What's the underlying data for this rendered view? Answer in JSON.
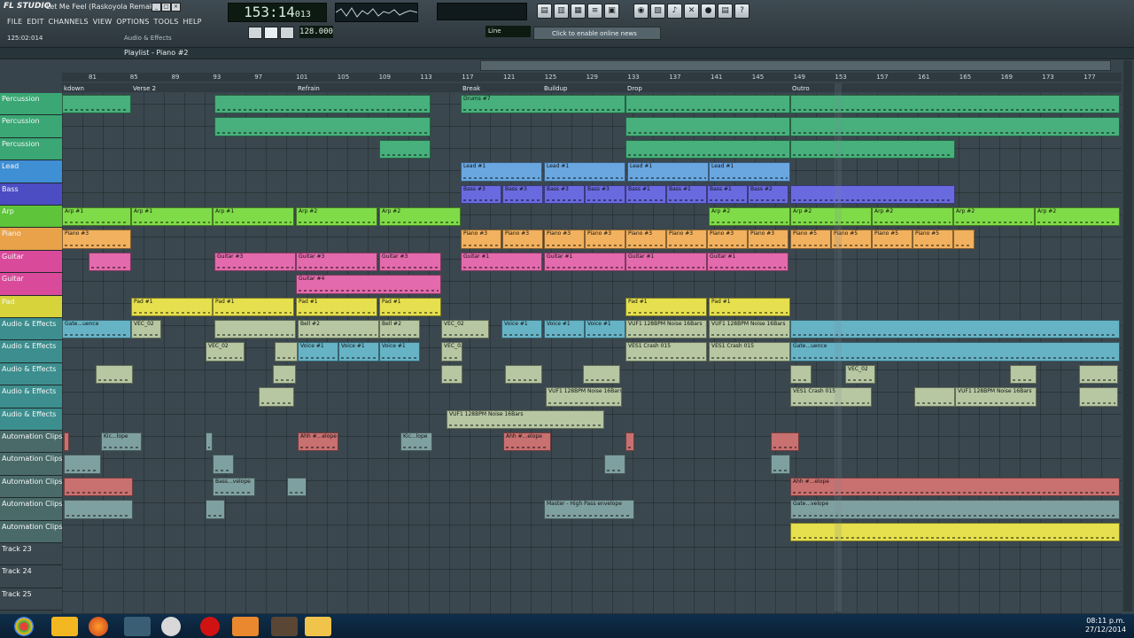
{
  "app": {
    "logo": "FL STUDIO",
    "title": "Let Me Feel (Raskoyola Remake)",
    "menus": [
      "FILE",
      "EDIT",
      "CHANNELS",
      "VIEW",
      "OPTIONS",
      "TOOLS",
      "HELP"
    ],
    "song_position": "125:02:014",
    "hint": "Audio & Effects"
  },
  "transport": {
    "time": "153:14",
    "ticks": "013",
    "tempo": "128.000",
    "pattern": "Line",
    "news": "Click to enable online news"
  },
  "playlist": {
    "title": "Playlist - Piano #2",
    "ruler": [
      "81",
      "85",
      "89",
      "93",
      "97",
      "101",
      "105",
      "109",
      "113",
      "117",
      "121",
      "125",
      "129",
      "133",
      "137",
      "141",
      "145",
      "149",
      "153",
      "157",
      "161",
      "165",
      "169",
      "173",
      "177"
    ],
    "markers": [
      "kdown",
      "Verse 2",
      "Refrain",
      "Break",
      "Buildup",
      "Drop",
      "Outro"
    ]
  },
  "tracks": [
    {
      "name": "Percussion",
      "color": "#3aa774"
    },
    {
      "name": "Percussion",
      "color": "#3aa774"
    },
    {
      "name": "Percussion",
      "color": "#3aa774"
    },
    {
      "name": "Lead",
      "color": "#3f8fd4"
    },
    {
      "name": "Bass",
      "color": "#4c4cc3"
    },
    {
      "name": "Arp",
      "color": "#5ec43a"
    },
    {
      "name": "Piano",
      "color": "#e9a24a"
    },
    {
      "name": "Guitar",
      "color": "#d94a9a"
    },
    {
      "name": "Guitar",
      "color": "#d94a9a"
    },
    {
      "name": "Pad",
      "color": "#d6d43a"
    },
    {
      "name": "Audio & Effects",
      "color": "#3d8e8e"
    },
    {
      "name": "Audio & Effects",
      "color": "#3d8e8e"
    },
    {
      "name": "Audio & Effects",
      "color": "#3d8e8e"
    },
    {
      "name": "Audio & Effects",
      "color": "#3d8e8e"
    },
    {
      "name": "Audio & Effects",
      "color": "#3d8e8e"
    },
    {
      "name": "Automation Clips",
      "color": "#4a6a6a"
    },
    {
      "name": "Automation Clips",
      "color": "#4a6a6a"
    },
    {
      "name": "Automation Clips",
      "color": "#4a6a6a"
    },
    {
      "name": "Automation Clips",
      "color": "#4a6a6a"
    },
    {
      "name": "Automation Clips",
      "color": "#4a6a6a"
    },
    {
      "name": "Track 23",
      "color": "#3a474e"
    },
    {
      "name": "Track 24",
      "color": "#3a474e"
    },
    {
      "name": "Track 25",
      "color": "#3a474e"
    }
  ],
  "clip_labels": {
    "drums": "Drums #7",
    "lead": "Lead #1",
    "bass3": "Bass #3",
    "bass1": "Bass #1",
    "bass2": "Bass #2",
    "arp1": "Arp #1",
    "arp2": "Arp #2",
    "piano3": "Piano #3",
    "piano5": "Piano #5",
    "guitar3": "Guitar #3",
    "guitar4": "Guitar #4",
    "guitar1": "Guitar #1",
    "pad": "Pad #1",
    "voice": "Voice #1",
    "bell": "Bell #2",
    "vec": "VEC_02",
    "noise": "VUF1 128BPM Noise 16Bars",
    "crash": "VES1 Crash 015",
    "gate": "Gate...uence",
    "master": "Master - High Pass envelope",
    "ahh": "Ahh #...elope",
    "kic": "Kic...lope",
    "bass_env": "Bass...velope",
    "gate_env": "Gate...velope"
  },
  "clock": {
    "time": "08:11 p.m.",
    "date": "27/12/2014"
  },
  "colors": {
    "accent": "#5ec43a",
    "lcd": "#0d1a12",
    "grid": "#3a474e"
  }
}
